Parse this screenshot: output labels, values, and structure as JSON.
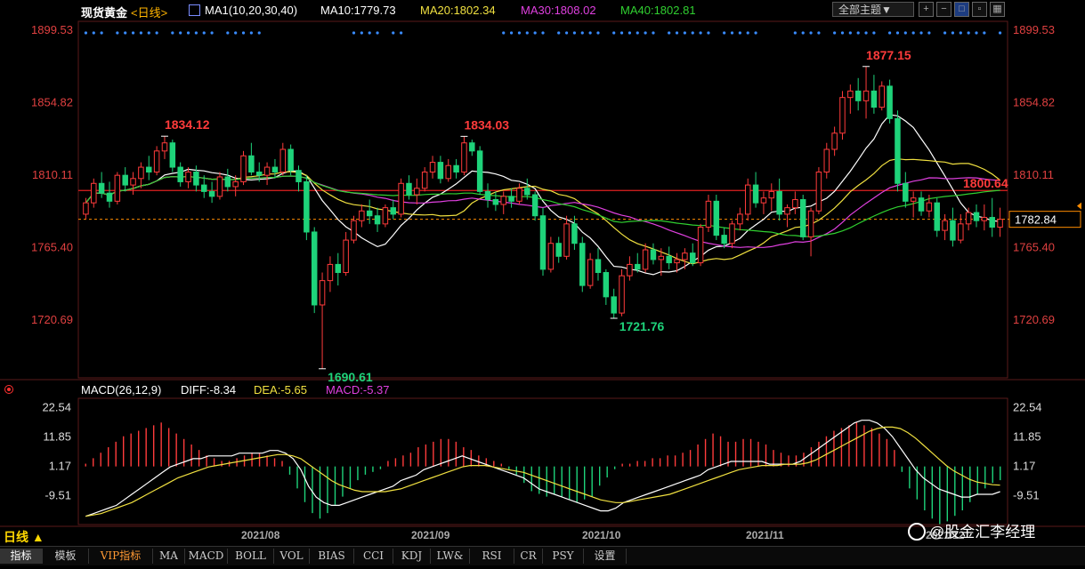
{
  "header": {
    "symbol": "现货黄金",
    "period": "<日线>",
    "ma_label": "MA1(10,20,30,40)",
    "ma10": "MA10:1779.73",
    "ma20": "MA20:1802.34",
    "ma30": "MA30:1808.02",
    "ma40": "MA40:1802.81",
    "theme_button": "全部主题▼"
  },
  "colors": {
    "up": "#ff3b3b",
    "down": "#1ed37a",
    "ma10": "#ffffff",
    "ma20": "#f0e040",
    "ma30": "#e040e0",
    "ma40": "#30d030",
    "price_axis": "#e04040",
    "dash": "#ff8c00",
    "dots": "#3a8cff"
  },
  "macd": {
    "label": "MACD(26,12,9)",
    "diff": "DIFF:-8.34",
    "dea": "DEA:-5.65",
    "macd": "MACD:-5.37"
  },
  "bottom": {
    "timeframe": "日线 ▲",
    "dates": [
      "2021/08",
      "2021/09",
      "2021/10",
      "2021/11",
      "2021/12"
    ]
  },
  "tabs": [
    "指标",
    "模板",
    "VIP指标",
    "MA",
    "MACD",
    "BOLL",
    "VOL",
    "BIAS",
    "CCI",
    "KDJ",
    "LW&",
    "RSI",
    "CR",
    "PSY",
    "设置"
  ],
  "watermark": "@股金汇李经理",
  "chart_data": [
    {
      "type": "candlestick",
      "title": "现货黄金 日线",
      "y_ticks": [
        1899.53,
        1854.82,
        1810.11,
        1765.4,
        1720.69
      ],
      "ylim": [
        1685,
        1905
      ],
      "horizontal_line": 1800.64,
      "last_price": 1782.84,
      "annotations": [
        {
          "text": "1834.12",
          "value": 1834.12
        },
        {
          "text": "1690.61",
          "value": 1690.61
        },
        {
          "text": "1834.03",
          "value": 1834.03
        },
        {
          "text": "1721.76",
          "value": 1721.76
        },
        {
          "text": "1877.15",
          "value": 1877.15
        },
        {
          "text": "1800.64",
          "value": 1800.64
        },
        {
          "text": "1782.84",
          "value": 1782.84
        }
      ],
      "candles": [
        [
          1786,
          1796,
          1783,
          1793
        ],
        [
          1793,
          1808,
          1790,
          1805
        ],
        [
          1805,
          1812,
          1796,
          1799
        ],
        [
          1799,
          1806,
          1790,
          1794
        ],
        [
          1794,
          1812,
          1792,
          1810
        ],
        [
          1810,
          1815,
          1800,
          1804
        ],
        [
          1804,
          1812,
          1798,
          1808
        ],
        [
          1808,
          1818,
          1802,
          1815
        ],
        [
          1815,
          1822,
          1807,
          1812
        ],
        [
          1812,
          1828,
          1810,
          1825
        ],
        [
          1825,
          1834,
          1820,
          1830
        ],
        [
          1830,
          1832,
          1812,
          1815
        ],
        [
          1815,
          1818,
          1803,
          1806
        ],
        [
          1806,
          1815,
          1802,
          1812
        ],
        [
          1812,
          1816,
          1800,
          1804
        ],
        [
          1804,
          1810,
          1796,
          1800
        ],
        [
          1800,
          1806,
          1793,
          1797
        ],
        [
          1797,
          1812,
          1795,
          1809
        ],
        [
          1809,
          1814,
          1800,
          1803
        ],
        [
          1803,
          1810,
          1797,
          1806
        ],
        [
          1806,
          1825,
          1804,
          1822
        ],
        [
          1822,
          1830,
          1810,
          1812
        ],
        [
          1812,
          1818,
          1806,
          1810
        ],
        [
          1810,
          1818,
          1804,
          1815
        ],
        [
          1815,
          1820,
          1808,
          1812
        ],
        [
          1812,
          1830,
          1810,
          1826
        ],
        [
          1826,
          1829,
          1810,
          1813
        ],
        [
          1813,
          1816,
          1800,
          1806
        ],
        [
          1806,
          1810,
          1770,
          1775
        ],
        [
          1775,
          1778,
          1725,
          1730
        ],
        [
          1730,
          1750,
          1690.61,
          1745
        ],
        [
          1745,
          1760,
          1738,
          1755
        ],
        [
          1755,
          1762,
          1742,
          1750
        ],
        [
          1750,
          1775,
          1748,
          1770
        ],
        [
          1770,
          1785,
          1768,
          1782
        ],
        [
          1782,
          1792,
          1778,
          1788
        ],
        [
          1788,
          1795,
          1780,
          1785
        ],
        [
          1785,
          1790,
          1775,
          1780
        ],
        [
          1780,
          1792,
          1778,
          1790
        ],
        [
          1790,
          1795,
          1783,
          1786
        ],
        [
          1786,
          1808,
          1784,
          1805
        ],
        [
          1805,
          1810,
          1795,
          1798
        ],
        [
          1798,
          1808,
          1792,
          1802
        ],
        [
          1802,
          1815,
          1800,
          1812
        ],
        [
          1812,
          1822,
          1808,
          1818
        ],
        [
          1818,
          1822,
          1805,
          1808
        ],
        [
          1808,
          1820,
          1806,
          1816
        ],
        [
          1816,
          1820,
          1808,
          1812
        ],
        [
          1812,
          1834.03,
          1810,
          1830
        ],
        [
          1830,
          1832,
          1822,
          1825
        ],
        [
          1825,
          1828,
          1798,
          1800
        ],
        [
          1800,
          1805,
          1790,
          1795
        ],
        [
          1795,
          1800,
          1788,
          1792
        ],
        [
          1792,
          1800,
          1786,
          1797
        ],
        [
          1797,
          1802,
          1790,
          1794
        ],
        [
          1794,
          1805,
          1792,
          1802
        ],
        [
          1802,
          1808,
          1795,
          1798
        ],
        [
          1798,
          1800,
          1782,
          1785
        ],
        [
          1785,
          1790,
          1748,
          1752
        ],
        [
          1752,
          1772,
          1750,
          1768
        ],
        [
          1768,
          1772,
          1756,
          1760
        ],
        [
          1760,
          1785,
          1758,
          1780
        ],
        [
          1780,
          1785,
          1764,
          1768
        ],
        [
          1768,
          1772,
          1738,
          1742
        ],
        [
          1742,
          1762,
          1740,
          1758
        ],
        [
          1758,
          1765,
          1745,
          1750
        ],
        [
          1750,
          1752,
          1730,
          1735
        ],
        [
          1735,
          1740,
          1721.76,
          1725
        ],
        [
          1725,
          1752,
          1723,
          1748
        ],
        [
          1748,
          1760,
          1745,
          1755
        ],
        [
          1755,
          1762,
          1750,
          1752
        ],
        [
          1752,
          1768,
          1750,
          1764
        ],
        [
          1764,
          1768,
          1755,
          1758
        ],
        [
          1758,
          1765,
          1748,
          1760
        ],
        [
          1760,
          1766,
          1752,
          1756
        ],
        [
          1756,
          1762,
          1750,
          1758
        ],
        [
          1758,
          1765,
          1752,
          1762
        ],
        [
          1762,
          1768,
          1754,
          1756
        ],
        [
          1756,
          1780,
          1754,
          1778
        ],
        [
          1778,
          1798,
          1775,
          1794
        ],
        [
          1794,
          1798,
          1770,
          1773
        ],
        [
          1773,
          1778,
          1765,
          1768
        ],
        [
          1768,
          1782,
          1765,
          1780
        ],
        [
          1780,
          1790,
          1776,
          1786
        ],
        [
          1786,
          1808,
          1782,
          1804
        ],
        [
          1804,
          1812,
          1790,
          1793
        ],
        [
          1793,
          1800,
          1786,
          1796
        ],
        [
          1796,
          1805,
          1788,
          1800
        ],
        [
          1800,
          1808,
          1782,
          1786
        ],
        [
          1786,
          1792,
          1778,
          1790
        ],
        [
          1790,
          1800,
          1786,
          1795
        ],
        [
          1795,
          1798,
          1770,
          1772
        ],
        [
          1772,
          1790,
          1760,
          1788
        ],
        [
          1788,
          1815,
          1786,
          1812
        ],
        [
          1812,
          1830,
          1808,
          1826
        ],
        [
          1826,
          1840,
          1822,
          1836
        ],
        [
          1836,
          1862,
          1832,
          1858
        ],
        [
          1858,
          1866,
          1848,
          1862
        ],
        [
          1862,
          1870,
          1850,
          1856
        ],
        [
          1856,
          1877.15,
          1845,
          1862
        ],
        [
          1862,
          1872,
          1848,
          1852
        ],
        [
          1852,
          1868,
          1850,
          1865
        ],
        [
          1865,
          1869,
          1842,
          1845
        ],
        [
          1845,
          1850,
          1800,
          1805
        ],
        [
          1805,
          1812,
          1790,
          1794
        ],
        [
          1794,
          1800,
          1784,
          1796
        ],
        [
          1796,
          1800,
          1785,
          1788
        ],
        [
          1788,
          1798,
          1784,
          1793
        ],
        [
          1793,
          1796,
          1772,
          1776
        ],
        [
          1776,
          1786,
          1770,
          1782
        ],
        [
          1782,
          1790,
          1766,
          1770
        ],
        [
          1770,
          1786,
          1768,
          1780
        ],
        [
          1780,
          1790,
          1776,
          1787
        ],
        [
          1787,
          1792,
          1778,
          1782
        ],
        [
          1782,
          1792,
          1776,
          1784
        ],
        [
          1784,
          1796,
          1772,
          1778
        ],
        [
          1778,
          1790,
          1772,
          1782.84
        ]
      ]
    },
    {
      "type": "bar",
      "title": "MACD(26,12,9)",
      "y_ticks": [
        22.54,
        11.85,
        1.17,
        -9.51
      ],
      "ylim": [
        -20,
        26
      ],
      "diff_last": -8.34,
      "dea_last": -5.65,
      "macd_last": -5.37,
      "histogram": [
        1,
        3,
        5,
        7,
        9,
        11,
        12,
        13,
        14,
        15,
        16,
        14,
        12,
        10,
        8,
        6,
        4,
        3,
        2,
        2,
        3,
        4,
        5,
        5,
        4,
        3,
        2,
        -3,
        -8,
        -13,
        -17,
        -19,
        -17,
        -14,
        -11,
        -8,
        -5,
        -3,
        -2,
        -1,
        2,
        3,
        4,
        5,
        7,
        8,
        9,
        10,
        10,
        9,
        7,
        6,
        4,
        3,
        2,
        1,
        -1,
        -3,
        -6,
        -9,
        -10,
        -11,
        -10,
        -11,
        -12,
        -13,
        -12,
        -11,
        -7,
        -4,
        -1,
        1,
        1,
        2,
        2,
        3,
        3,
        4,
        4,
        5,
        6,
        8,
        10,
        12,
        11,
        9,
        9,
        10,
        10,
        9,
        8,
        6,
        5,
        4,
        4,
        5,
        7,
        9,
        11,
        13,
        14,
        15,
        16,
        15,
        14,
        12,
        10,
        6,
        -2,
        -8,
        -12,
        -16,
        -19,
        -21,
        -20,
        -18,
        -16,
        -13,
        -10,
        -8,
        -6,
        -5
      ],
      "diff": [
        -17,
        -16,
        -15,
        -14,
        -13,
        -11,
        -9,
        -7,
        -5,
        -3,
        -1,
        1,
        2,
        3,
        4,
        4,
        5,
        5,
        5,
        5,
        6,
        6,
        6,
        6,
        7,
        7,
        6,
        4,
        0,
        -6,
        -10,
        -12,
        -13,
        -13,
        -12,
        -11,
        -10,
        -9,
        -8,
        -7,
        -6,
        -4,
        -3,
        -2,
        0,
        1,
        2,
        3,
        4,
        5,
        4,
        3,
        2,
        1,
        0,
        -1,
        -2,
        -3,
        -5,
        -7,
        -8,
        -9,
        -10,
        -11,
        -12,
        -13,
        -14,
        -15,
        -15,
        -14,
        -12,
        -11,
        -10,
        -9,
        -8,
        -7,
        -6,
        -5,
        -4,
        -3,
        -2,
        0,
        1,
        2,
        3,
        3,
        3,
        3,
        3,
        2,
        2,
        2,
        2,
        3,
        5,
        7,
        9,
        11,
        13,
        15,
        17,
        18,
        18,
        17,
        15,
        12,
        8,
        4,
        0,
        -3,
        -5,
        -7,
        -8,
        -9,
        -10,
        -10,
        -9,
        -9,
        -9,
        -8
      ],
      "dea": [
        -17,
        -16.5,
        -16,
        -15,
        -14,
        -13,
        -12,
        -10.5,
        -9,
        -7.5,
        -6,
        -4.5,
        -3,
        -2,
        -1,
        0,
        1,
        1.5,
        2,
        2.5,
        3,
        3.5,
        4,
        4.5,
        5,
        5.5,
        5.5,
        5,
        4,
        2,
        0,
        -2,
        -4,
        -5.5,
        -6.5,
        -7.5,
        -8,
        -8,
        -8,
        -8,
        -7.5,
        -7,
        -6,
        -5,
        -4,
        -3,
        -2,
        -1,
        0,
        1,
        1.5,
        1.5,
        1.5,
        1,
        0.5,
        0,
        -0.5,
        -1,
        -2,
        -3,
        -4,
        -5,
        -6,
        -7,
        -8,
        -9,
        -10,
        -11,
        -11.5,
        -12,
        -12,
        -11.5,
        -11,
        -10.5,
        -10,
        -9.5,
        -9,
        -8,
        -7,
        -6,
        -5,
        -4,
        -3,
        -2,
        -1,
        0,
        0.5,
        1,
        1.5,
        1.5,
        1.5,
        2,
        2,
        2,
        2.5,
        3.5,
        5,
        6.5,
        8,
        9.5,
        11,
        12.5,
        14,
        15,
        15.5,
        15.5,
        15,
        13.5,
        11.5,
        9,
        6.5,
        4,
        1.5,
        -0.5,
        -2,
        -3.5,
        -4.5,
        -5,
        -5.5,
        -5.65
      ]
    }
  ]
}
